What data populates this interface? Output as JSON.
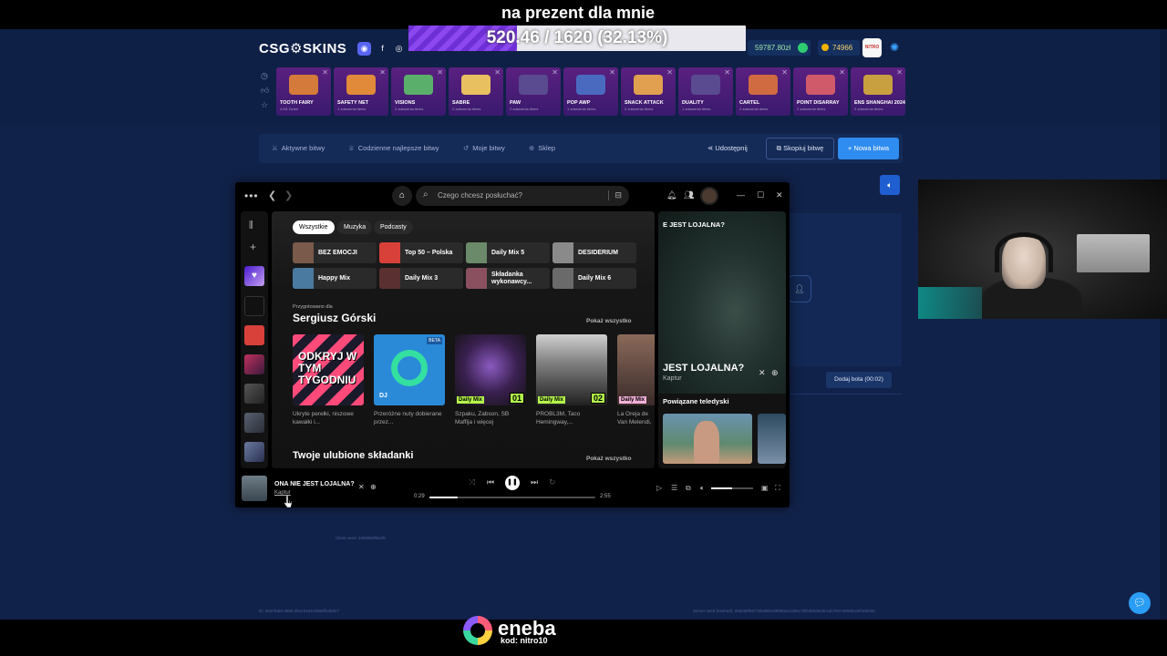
{
  "overlay": {
    "goal_title": "na prezent dla mnie",
    "goal_text": "520.46 / 1620 (32.13%)",
    "goal_progress": 0.3213,
    "sponsor_name": "eneba",
    "sponsor_code": "kod: nitro10"
  },
  "site": {
    "logo": "CSG⚙SKINS",
    "balance": "59787.80zł",
    "coins": "74966",
    "avatar_text": "NITRO",
    "cases": [
      {
        "name": "TOOTH FAIRY",
        "sub": "4 M1 Dzień",
        "color": "#d47a3a"
      },
      {
        "name": "SAFETY NET",
        "sub": "1 zdarzenia items",
        "color": "#e08a3a"
      },
      {
        "name": "VISIONS",
        "sub": "2 zdarzenia items",
        "color": "#5ab06a"
      },
      {
        "name": "SABRE",
        "sub": "2 zdarzenia items",
        "color": "#e8c060"
      },
      {
        "name": "PAW",
        "sub": "2 zdarzenia items",
        "color": "#5a4a90"
      },
      {
        "name": "POP AWP",
        "sub": "1 zdarzenia items",
        "color": "#4a6ac0"
      },
      {
        "name": "SNACK ATTACK",
        "sub": "2 zdarzenia items",
        "color": "#e0a050"
      },
      {
        "name": "DUALITY",
        "sub": "1 zdarzenia items",
        "color": "#5a4a90"
      },
      {
        "name": "CARTEL",
        "sub": "2 zdarzenia items",
        "color": "#d06a40"
      },
      {
        "name": "POINT DISARRAY",
        "sub": "2 zdarzenia items",
        "color": "#d05a6a"
      },
      {
        "name": "ENS SHANGHAI 2024",
        "sub": "2 zdarzenia items",
        "color": "#c8a040"
      }
    ],
    "nav": {
      "active_battles": "Aktywne bitwy",
      "daily_best": "Codzienne najlepsze bitwy",
      "my_battles": "Moje bitwy",
      "shop": "Sklep",
      "share": "Udostępnij",
      "copy_battle": "Skopiuj bitwę",
      "new_battle": "+ Nowa bitwa"
    },
    "add_bot": "Dodaj bota (00:02)",
    "server_seed": "Client seed: 32808b9fb6cf0",
    "footer_id": "ID: 6ea7fab9-d084-4fea-b445-b855ff1d5dc7",
    "footer_seed": "Server seed (hashed): 0582d8f6577ded90ed3f6b0a4128ec7bf63b0de0dccdc7627450d0cebf4d2025"
  },
  "spotify": {
    "search_placeholder": "Czego chcesz posłuchać?",
    "chips": [
      "Wszystkie",
      "Muzyka",
      "Podcasty"
    ],
    "quick": [
      {
        "label": "BEZ EMOCJI",
        "color": "#7a5a4a"
      },
      {
        "label": "Top 50 – Polska",
        "color": "#d8403a"
      },
      {
        "label": "Daily Mix 5",
        "color": "#6a8a6a"
      },
      {
        "label": "DESIDERIUM",
        "color": "#8a8a8a"
      },
      {
        "label": "Happy Mix",
        "color": "#4a7aa0"
      },
      {
        "label": "Daily Mix 3",
        "color": "#5a3030"
      },
      {
        "label": "Składanka wykonawcy...",
        "color": "#8a5060"
      },
      {
        "label": "Daily Mix 6",
        "color": "#6a6a6a"
      }
    ],
    "made_for": "Przygotowano dla",
    "user_name": "Sergiusz Górski",
    "show_all": "Pokaż wszystko",
    "cards": [
      {
        "desc": "Ukryte perełki, niszowe kawałki i...",
        "art_text": "ODKRYJ W TYM TYGODNIU"
      },
      {
        "desc": "Przeróżne nuty dobierane przez...",
        "art_text": "DJ",
        "badge": "BETA"
      },
      {
        "desc": "Szpaku, Żabson, SB Maffija i więcej",
        "badge": "Daily Mix",
        "num": "01"
      },
      {
        "desc": "PROBL3M, Taco Hemingway,...",
        "badge": "Daily Mix",
        "num": "02"
      },
      {
        "desc": "La Oreja de Van Melendi, Sh...",
        "badge": "Daily Mix"
      }
    ],
    "fav_title": "Twoje ulubione składanki",
    "now_playing": {
      "title_top": "E JEST LOJALNA?",
      "title": "JEST LOJALNA?",
      "artist": "Kaptur",
      "related": "Powiązane teledyski"
    },
    "player": {
      "title": "ONA NIE JEST LOJALNA?",
      "artist": "Kaptur",
      "current": "0:29",
      "duration": "2:55",
      "progress": 0.17,
      "volume": 0.5
    }
  }
}
